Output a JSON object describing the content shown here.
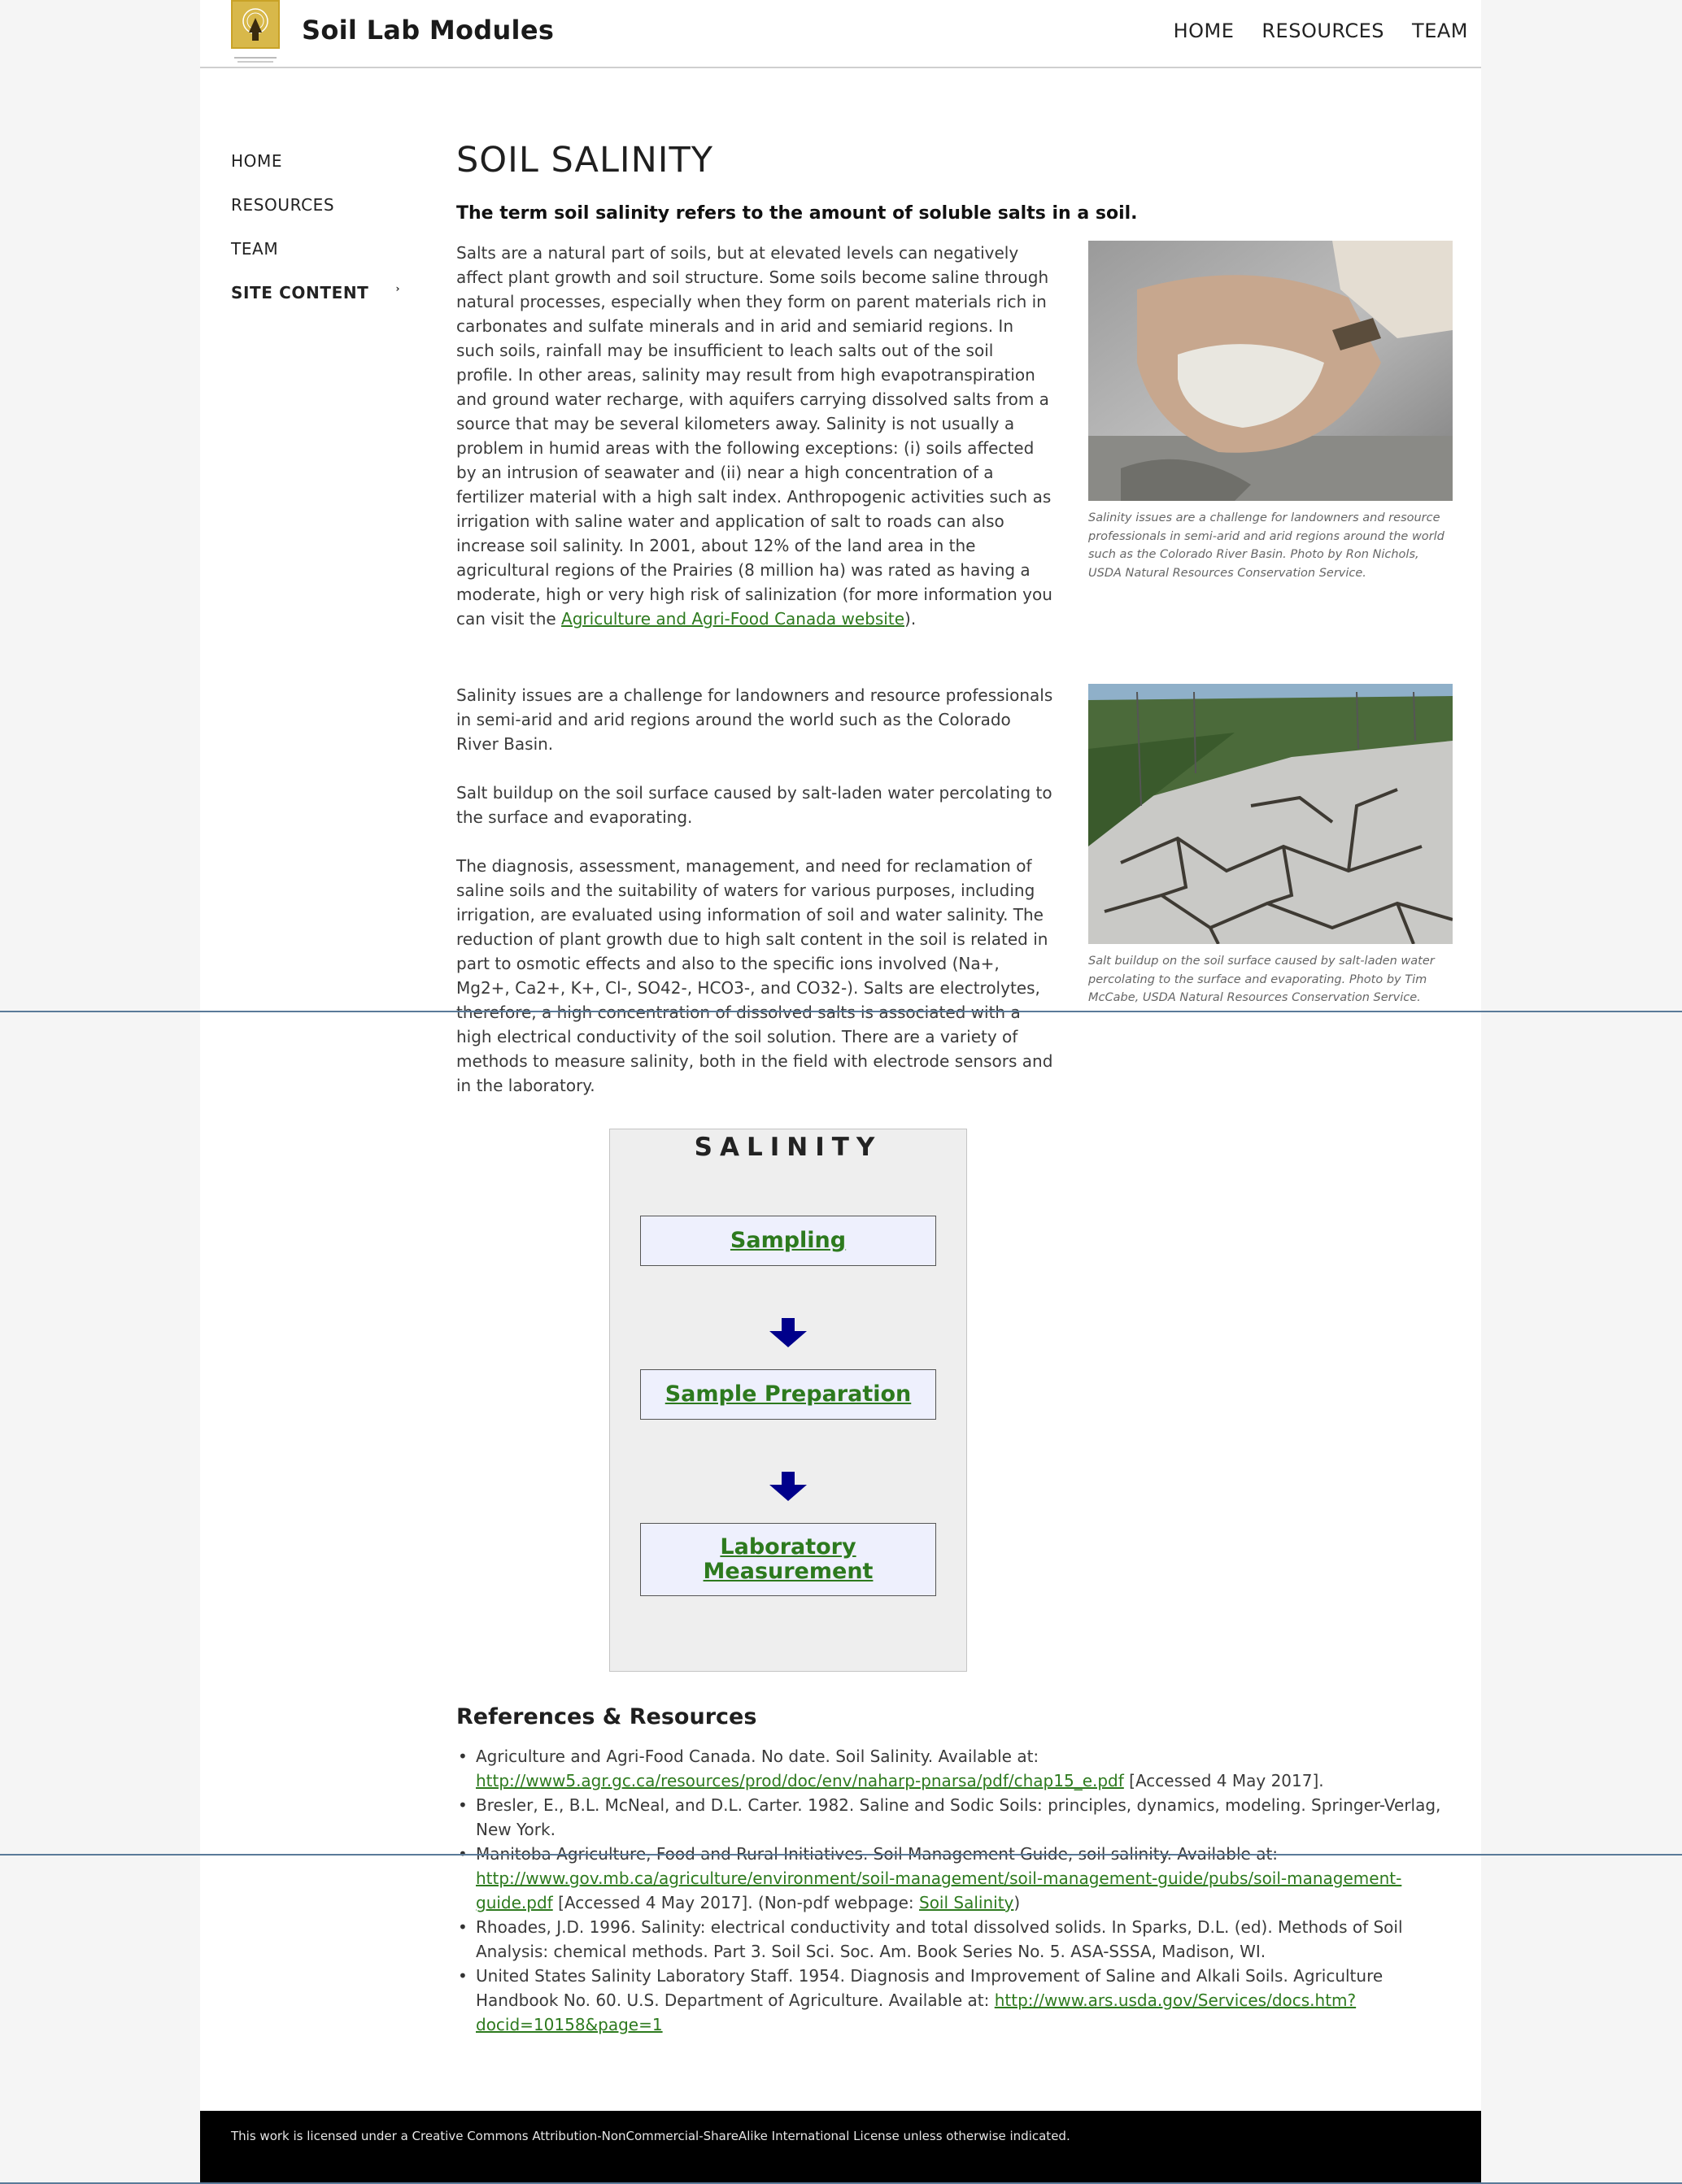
{
  "header": {
    "site_title": "Soil Lab Modules",
    "nav": [
      "HOME",
      "RESOURCES",
      "TEAM"
    ]
  },
  "sidebar": {
    "items": [
      {
        "label": "HOME"
      },
      {
        "label": "RESOURCES"
      },
      {
        "label": "TEAM"
      },
      {
        "label": "SITE CONTENT",
        "caret": "›"
      }
    ]
  },
  "main": {
    "title": "SOIL SALINITY",
    "lead": "The term soil salinity refers to the amount of soluble salts in a soil.",
    "intro_text": "Salts are a natural part of soils, but at elevated levels can negatively affect plant growth and soil structure.  Some soils become saline through natural processes, especially when they form on parent materials rich in carbonates and sulfate minerals and in arid and semiarid regions. In such soils, rainfall may be insufficient to leach salts out of the soil profile.  In other areas, salinity may result from high evapotranspiration and ground water recharge, with aquifers carrying dissolved salts from a source that may be several kilometers away.  Salinity is not usually a problem in humid areas with the following exceptions: (i) soils affected by an intrusion of seawater and (ii) near a high concentration of a fertilizer material with a high salt index.  Anthropogenic activities such as irrigation with saline water and application of salt to roads can also increase soil salinity. In 2001, about 12% of the land area in the agricultural regions of the Prairies (8 million ha) was rated as having a moderate, high or very high risk of salinization (for more information you can visit the ",
    "intro_link": "Agriculture and Agri-Food Canada website",
    "intro_end": ").",
    "para2": "Salinity issues are a challenge for landowners and resource professionals in semi-arid and arid regions around the world such as the Colorado River Basin.",
    "para3": "Salt buildup on the soil surface caused by salt-laden water percolating to the surface and evaporating.",
    "para4": "The diagnosis, assessment, management, and need for reclamation of saline soils and the suitability of waters for various purposes, including irrigation, are evaluated using information of soil and water salinity. The reduction of plant growth due to high salt content in the soil is related in part to osmotic effects and also to the specific ions involved (Na+, Mg2+, Ca2+, K+, Cl-, SO42-, HCO3-, and CO32-).  Salts are electrolytes, therefore, a high concentration of dissolved salts is associated with a high electrical conductivity of the soil solution.  There are a variety of methods to measure salinity, both in the field with electrode sensors and in the laboratory."
  },
  "figures": [
    {
      "caption": "Salinity issues are a challenge for landowners and resource professionals in semi-arid and arid regions around the world such as the Colorado River Basin. Photo by Ron Nichols, USDA Natural Resources Conservation Service."
    },
    {
      "caption": "Salt buildup on the soil surface caused by salt-laden water percolating to the surface and evaporating. Photo by Tim McCabe, USDA Natural Resources Conservation Service."
    }
  ],
  "flow": {
    "title": "SALINITY",
    "steps": [
      {
        "label": "Sampling"
      },
      {
        "label": "Sample Preparation"
      },
      {
        "label": "Laboratory Measurement"
      }
    ],
    "arrow_color": "#00008b"
  },
  "references": {
    "title": "References & Resources",
    "items": [
      {
        "pre": "Agriculture and Agri-Food Canada. No date. Soil Salinity. Available at: ",
        "link": "http://www5.agr.gc.ca/resources/prod/doc/env/naharp-pnarsa/pdf/chap15_e.pdf",
        "post": " [Accessed 4 May 2017]."
      },
      {
        "pre": "Bresler, E., B.L. McNeal, and D.L. Carter. 1982.  Saline and Sodic Soils: principles, dynamics, modeling.  Springer-Verlag, New York.",
        "link": "",
        "post": ""
      },
      {
        "pre": "Manitoba Agriculture, Food and Rural Initiatives. Soil Management Guide, soil salinity.  Available at: ",
        "link": "http://www.gov.mb.ca/agriculture/environment/soil-management/soil-management-guide/pubs/soil-management-guide.pdf",
        "post": " [Accessed 4 May 2017]. (Non-pdf webpage: ",
        "link2": "Soil Salinity",
        "post2": ")"
      },
      {
        "pre": "Rhoades, J.D. 1996.  Salinity: electrical conductivity and total dissolved solids. In Sparks, D.L. (ed). Methods of Soil Analysis: chemical methods. Part 3. Soil Sci. Soc. Am. Book Series No. 5. ASA-SSSA, Madison, WI.",
        "link": "",
        "post": ""
      },
      {
        "pre": "United States Salinity Laboratory Staff. 1954.  Diagnosis and Improvement of Saline and Alkali Soils. Agriculture Handbook No. 60. U.S. Department of Agriculture. Available at: ",
        "link": "http://www.ars.usda.gov/Services/docs.htm?docid=10158&page=1",
        "post": ""
      }
    ]
  },
  "footer": {
    "text": "This work is licensed under a Creative Commons Attribution-NonCommercial-ShareAlike International License unless otherwise indicated."
  },
  "colors": {
    "link": "#2d7a1e",
    "flow_box_bg": "#eeeeee",
    "flow_step_bg": "#eef0fd",
    "footer_bg": "#000000"
  }
}
